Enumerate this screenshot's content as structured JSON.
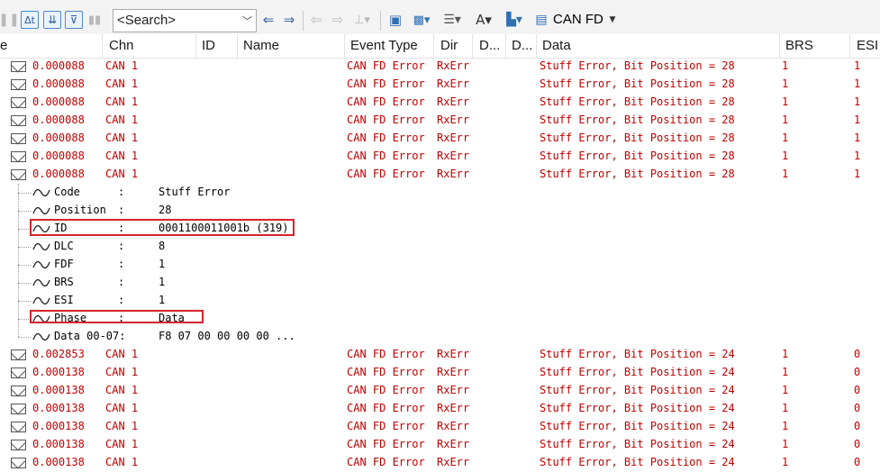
{
  "toolbar": {
    "search_placeholder": "<Search>",
    "channel_filter": "CAN FD",
    "icons": [
      "pause-icon",
      "delta-time-icon",
      "scroll-lock-icon",
      "filter-icon",
      "column-icon",
      "back-icon",
      "forward-icon",
      "insert-icon",
      "new-window-icon",
      "highlight-icon",
      "view-icon",
      "font-size-icon",
      "layout-icon",
      "can-fd-icon"
    ]
  },
  "columns": [
    "e",
    "Chn",
    "ID",
    "Name",
    "Event Type",
    "Dir",
    "D...",
    "D...",
    "Data",
    "BRS",
    "ESI"
  ],
  "rows_top": [
    {
      "time": "0.000088",
      "chn": "CAN 1",
      "event": "CAN FD Error",
      "dir": "RxErr",
      "data": "Stuff Error, Bit Position = 28",
      "brs": "1",
      "esi": "1"
    },
    {
      "time": "0.000088",
      "chn": "CAN 1",
      "event": "CAN FD Error",
      "dir": "RxErr",
      "data": "Stuff Error, Bit Position = 28",
      "brs": "1",
      "esi": "1"
    },
    {
      "time": "0.000088",
      "chn": "CAN 1",
      "event": "CAN FD Error",
      "dir": "RxErr",
      "data": "Stuff Error, Bit Position = 28",
      "brs": "1",
      "esi": "1"
    },
    {
      "time": "0.000088",
      "chn": "CAN 1",
      "event": "CAN FD Error",
      "dir": "RxErr",
      "data": "Stuff Error, Bit Position = 28",
      "brs": "1",
      "esi": "1"
    },
    {
      "time": "0.000088",
      "chn": "CAN 1",
      "event": "CAN FD Error",
      "dir": "RxErr",
      "data": "Stuff Error, Bit Position = 28",
      "brs": "1",
      "esi": "1"
    },
    {
      "time": "0.000088",
      "chn": "CAN 1",
      "event": "CAN FD Error",
      "dir": "RxErr",
      "data": "Stuff Error, Bit Position = 28",
      "brs": "1",
      "esi": "1"
    },
    {
      "time": "0.000088",
      "chn": "CAN 1",
      "event": "CAN FD Error",
      "dir": "RxErr",
      "data": "Stuff Error, Bit Position = 28",
      "brs": "1",
      "esi": "1"
    }
  ],
  "details": [
    {
      "label": "Code",
      "sep": ":",
      "value": "Stuff Error"
    },
    {
      "label": "Position",
      "sep": ":",
      "value": "28"
    },
    {
      "label": "ID",
      "sep": ":",
      "value": "0001100011001b (319)"
    },
    {
      "label": "DLC",
      "sep": ":",
      "value": "8"
    },
    {
      "label": "FDF",
      "sep": ":",
      "value": "1"
    },
    {
      "label": "BRS",
      "sep": ":",
      "value": "1"
    },
    {
      "label": "ESI",
      "sep": ":",
      "value": "1"
    },
    {
      "label": "Phase",
      "sep": ":",
      "value": "Data"
    },
    {
      "label": "Data 00-07:",
      "sep": "",
      "value": "F8 07 00 00 00 00  ..."
    }
  ],
  "rows_bottom": [
    {
      "time": "0.002853",
      "chn": "CAN 1",
      "event": "CAN FD Error",
      "dir": "RxErr",
      "data": "Stuff Error, Bit Position = 24",
      "brs": "1",
      "esi": "0"
    },
    {
      "time": "0.000138",
      "chn": "CAN 1",
      "event": "CAN FD Error",
      "dir": "RxErr",
      "data": "Stuff Error, Bit Position = 24",
      "brs": "1",
      "esi": "0"
    },
    {
      "time": "0.000138",
      "chn": "CAN 1",
      "event": "CAN FD Error",
      "dir": "RxErr",
      "data": "Stuff Error, Bit Position = 24",
      "brs": "1",
      "esi": "0"
    },
    {
      "time": "0.000138",
      "chn": "CAN 1",
      "event": "CAN FD Error",
      "dir": "RxErr",
      "data": "Stuff Error, Bit Position = 24",
      "brs": "1",
      "esi": "0"
    },
    {
      "time": "0.000138",
      "chn": "CAN 1",
      "event": "CAN FD Error",
      "dir": "RxErr",
      "data": "Stuff Error, Bit Position = 24",
      "brs": "1",
      "esi": "0"
    },
    {
      "time": "0.000138",
      "chn": "CAN 1",
      "event": "CAN FD Error",
      "dir": "RxErr",
      "data": "Stuff Error, Bit Position = 24",
      "brs": "1",
      "esi": "0"
    },
    {
      "time": "0.000138",
      "chn": "CAN 1",
      "event": "CAN FD Error",
      "dir": "RxErr",
      "data": "Stuff Error, Bit Position = 24",
      "brs": "1",
      "esi": "0"
    }
  ],
  "colors": {
    "error_text": "#c00000",
    "highlight_box": "#d8222a"
  }
}
